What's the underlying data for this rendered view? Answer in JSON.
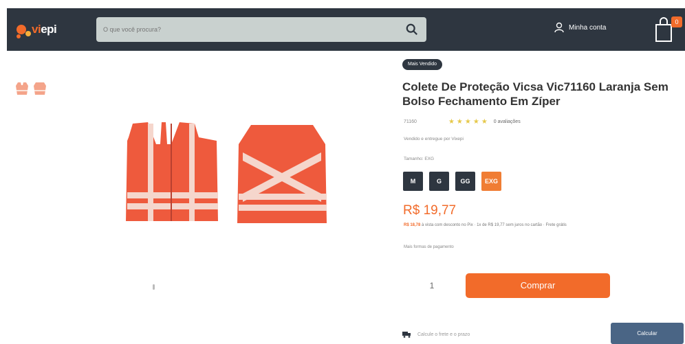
{
  "header": {
    "logo_prefix": "vi",
    "logo_suffix": "epi",
    "search_placeholder": "O que você procura?",
    "account_label": "Minha conta",
    "cart_count": "0"
  },
  "product": {
    "badge": "Mais Vendido",
    "title": "Colete De Proteção Vicsa Vic71160 Laranja Sem Bolso Fechamento Em Zíper",
    "sku": "71160",
    "rating_text": "0 avaliações",
    "seller": "Vendido e entregue por Vixepi",
    "size_label": "Tamanho: EXG",
    "sizes": [
      "M",
      "G",
      "GG",
      "EXG"
    ],
    "selected_size": "EXG",
    "price": "R$ 19,77",
    "installment_bold": "R$ 18,78",
    "installment_text": "à vista com desconto no Pix · 1x de R$ 19,77 sem juros no cartão · Frete grátis",
    "more_options": "Mais formas de pagamento",
    "quantity": "1",
    "buy_label": "Comprar"
  },
  "shipping": {
    "label": "Calcule o frete e o prazo",
    "button_label": "Calcular"
  },
  "colors": {
    "header_bg": "#2e3640",
    "accent": "#f26b2a",
    "calc_btn": "#4a6585"
  }
}
